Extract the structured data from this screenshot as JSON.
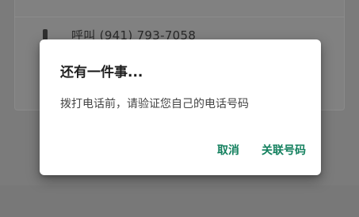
{
  "background": {
    "call_label": "呼叫 (941) 793-7058"
  },
  "dialog": {
    "title": "还有一件事...",
    "message": "拨打电话前，请验证您自己的电话号码",
    "cancel_label": "取消",
    "link_label": "关联号码"
  },
  "colors": {
    "accent": "#13805e",
    "scrim": "#7b7b7b"
  }
}
